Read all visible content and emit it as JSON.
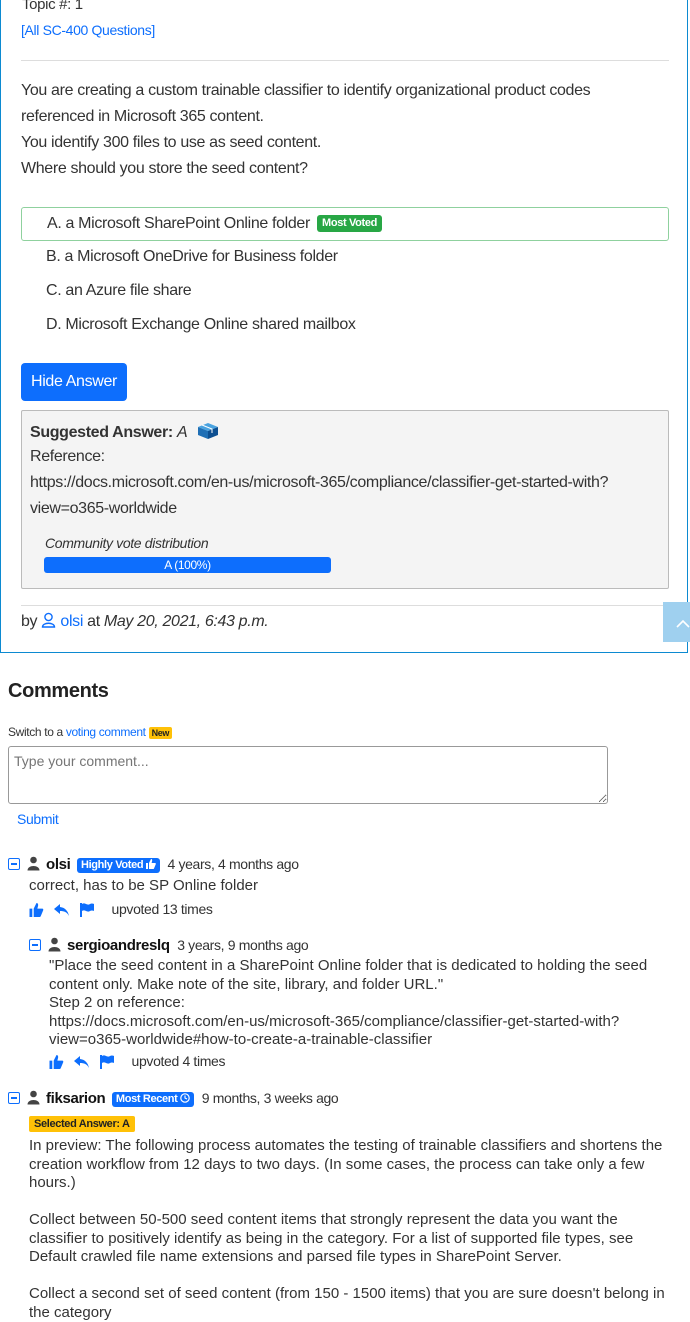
{
  "question": {
    "topic": "Topic #: 1",
    "all_questions_link": "[All SC-400 Questions]",
    "text_lines": [
      "You are creating a custom trainable classifier to identify organizational product codes referenced in Microsoft 365 content.",
      "You identify 300 files to use as seed content.",
      "Where should you store the seed content?"
    ],
    "choices": [
      {
        "label": "A. a Microsoft SharePoint Online folder",
        "badge": "Most Voted"
      },
      {
        "label": "B. a Microsoft OneDrive for Business folder"
      },
      {
        "label": "C. an Azure file share"
      },
      {
        "label": "D. Microsoft Exchange Online shared mailbox"
      }
    ],
    "hide_answer_button": "Hide Answer",
    "suggested_answer_label": "Suggested Answer:",
    "suggested_answer_value": "A",
    "reference_label": "Reference:",
    "reference_url_line1": "https://docs.microsoft.com/en-us/microsoft-365/compliance/classifier-get-started-with?",
    "reference_url_line2": "view=o365-worldwide",
    "community_vote_label": "Community vote distribution",
    "vote_bar_label": "A (100%)",
    "vote_bar_fraction": 1.0,
    "by_label": "by",
    "author": "olsi",
    "at_label": "at",
    "date": "May 20, 2021, 6:43 p.m."
  },
  "comments_section": {
    "heading": "Comments",
    "switch_text": "Switch to a",
    "switch_link": "voting comment",
    "switch_badge": "New",
    "textarea_placeholder": "Type your comment...",
    "submit_label": "Submit"
  },
  "comments": [
    {
      "user": "olsi",
      "badge": "Highly Voted",
      "time": "4 years, 4 months ago",
      "body": "correct, has to be SP Online folder",
      "upvotes": "upvoted 13 times"
    },
    {
      "user": "sergioandreslq",
      "time": "3 years, 9 months ago",
      "body": "\"Place the seed content in a SharePoint Online folder that is dedicated to holding the seed content only. Make note of the site, library, and folder URL.\"\nStep 2 on reference:\nhttps://docs.microsoft.com/en-us/microsoft-365/compliance/classifier-get-started-with?view=o365-worldwide#how-to-create-a-trainable-classifier",
      "upvotes": "upvoted 4 times"
    },
    {
      "user": "fiksarion",
      "badge": "Most Recent",
      "time": "9 months, 3 weeks ago",
      "selected_answer": "Selected Answer: A",
      "body": "In preview: The following process automates the testing of trainable classifiers and shortens the creation workflow from 12 days to two days. (In some cases, the process can take only a few hours.)\n\nCollect between 50-500 seed content items that strongly represent the data you want the classifier to positively identify as being in the category. For a list of supported file types, see Default crawled file name extensions and parsed file types in SharePoint Server.\n\nCollect a second set of seed content (from 150 - 1500 items) that you are sure doesn't belong in the category"
    }
  ],
  "colors": {
    "primary": "#0d6efd",
    "success": "#28a745",
    "warning": "#ffc107",
    "card_border": "#0c8ad1"
  }
}
